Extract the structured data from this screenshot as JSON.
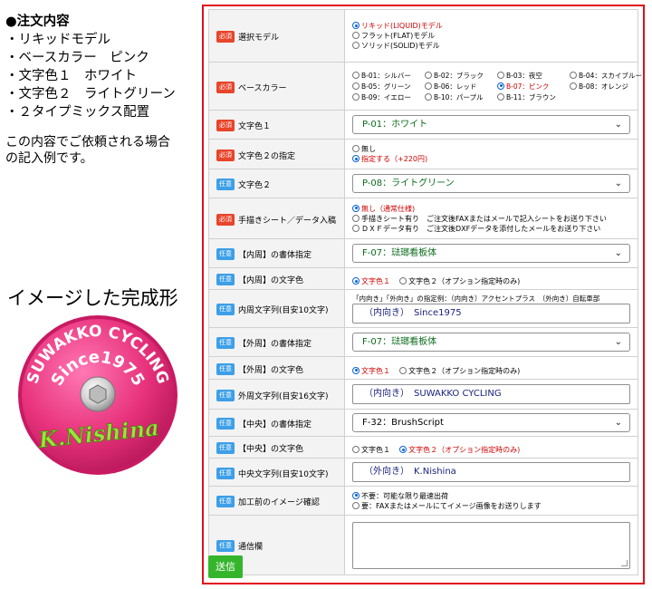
{
  "order": {
    "heading": "●注文内容",
    "items": [
      "・リキッドモデル",
      "・ベースカラー　ピンク",
      "・文字色１　ホワイト",
      "・文字色２　ライトグリーン",
      "・２タイプミックス配置"
    ],
    "note_1": "この内容でご依頼される場合",
    "note_2": "の記入例です。"
  },
  "image_title": "イメージした完成形",
  "badge": {
    "top_text": "SUWAKKO CYCLING",
    "middle_text": "Since1975",
    "bottom_text": "K.Nishina"
  },
  "tags": {
    "required": "必須",
    "optional": "任意"
  },
  "form": {
    "model": {
      "label": "選択モデル",
      "options": [
        "リキッド(LIQUID)モデル",
        "フラット(FLAT)モデル",
        "ソリッド(SOLID)モデル"
      ]
    },
    "base_color": {
      "label": "ベースカラー",
      "options": [
        "B-01：シルバー",
        "B-02：ブラック",
        "B-03：夜空",
        "B-04：スカイブルー",
        "B-05：グリーン",
        "B-06：レッド",
        "B-07：ピンク",
        "B-08：オレンジ",
        "B-09：イエロー",
        "B-10：パープル",
        "B-11：ブラウン"
      ]
    },
    "text_color_1": {
      "label": "文字色１",
      "value": "P-01：ホワイト"
    },
    "text_color_2_spec": {
      "label": "文字色２の指定",
      "options": [
        "無し",
        "指定する（+220円)"
      ]
    },
    "text_color_2": {
      "label": "文字色２",
      "value": "P-08：ライトグリーン"
    },
    "handwriting": {
      "label": "手描きシート／データ入稿",
      "options": [
        "無し（通常仕様)",
        "手描きシート有り　ご注文後FAXまたはメールで記入シートをお送り下さい",
        "ＤＸＦデータ有り　ご注文後DXFデータを添付したメールをお送り下さい"
      ]
    },
    "inner_font": {
      "label": "【内周】の書体指定",
      "value": "F-07：琺瑯看板体"
    },
    "inner_color": {
      "label": "【内周】の文字色",
      "options": [
        "文字色１",
        "文字色２（オプション指定時のみ)"
      ]
    },
    "inner_text": {
      "label": "内周文字列(目安10文字)",
      "hint": "「内向き」「外向き」の指定例：（内向き）アクセントプラス　（外向き）自転車部",
      "value": "（内向き）　Since1975"
    },
    "outer_font": {
      "label": "【外周】の書体指定",
      "value": "F-07：琺瑯看板体"
    },
    "outer_color": {
      "label": "【外周】の文字色",
      "options": [
        "文字色１",
        "文字色２（オプション指定時のみ)"
      ]
    },
    "outer_text": {
      "label": "外周文字列(目安16文字)",
      "value": "（内向き）　SUWAKKO CYCLING"
    },
    "center_font": {
      "label": "【中央】の書体指定",
      "value": "F-32：BrushScript"
    },
    "center_color": {
      "label": "【中央】の文字色",
      "options": [
        "文字色１",
        "文字色２（オプション指定時のみ)"
      ]
    },
    "center_text": {
      "label": "中央文字列(目安10文字)",
      "value": "（外向き）　K.Nishina"
    },
    "preview": {
      "label": "加工前のイメージ確認",
      "options": [
        "不要：可能な限り最速出荷",
        "要：FAXまたはメールにてイメージ画像をお送りします"
      ]
    },
    "memo": {
      "label": "通信欄",
      "value": ""
    }
  },
  "submit_label": "送信",
  "colors": {
    "frame": "#e0101a",
    "required_tag": "#e8452b",
    "optional_tag": "#3d9fe8",
    "submit": "#35b52c",
    "badge_pink": "#e8327c",
    "badge_green": "#9be53a",
    "select_green": "#0b6b1c"
  }
}
